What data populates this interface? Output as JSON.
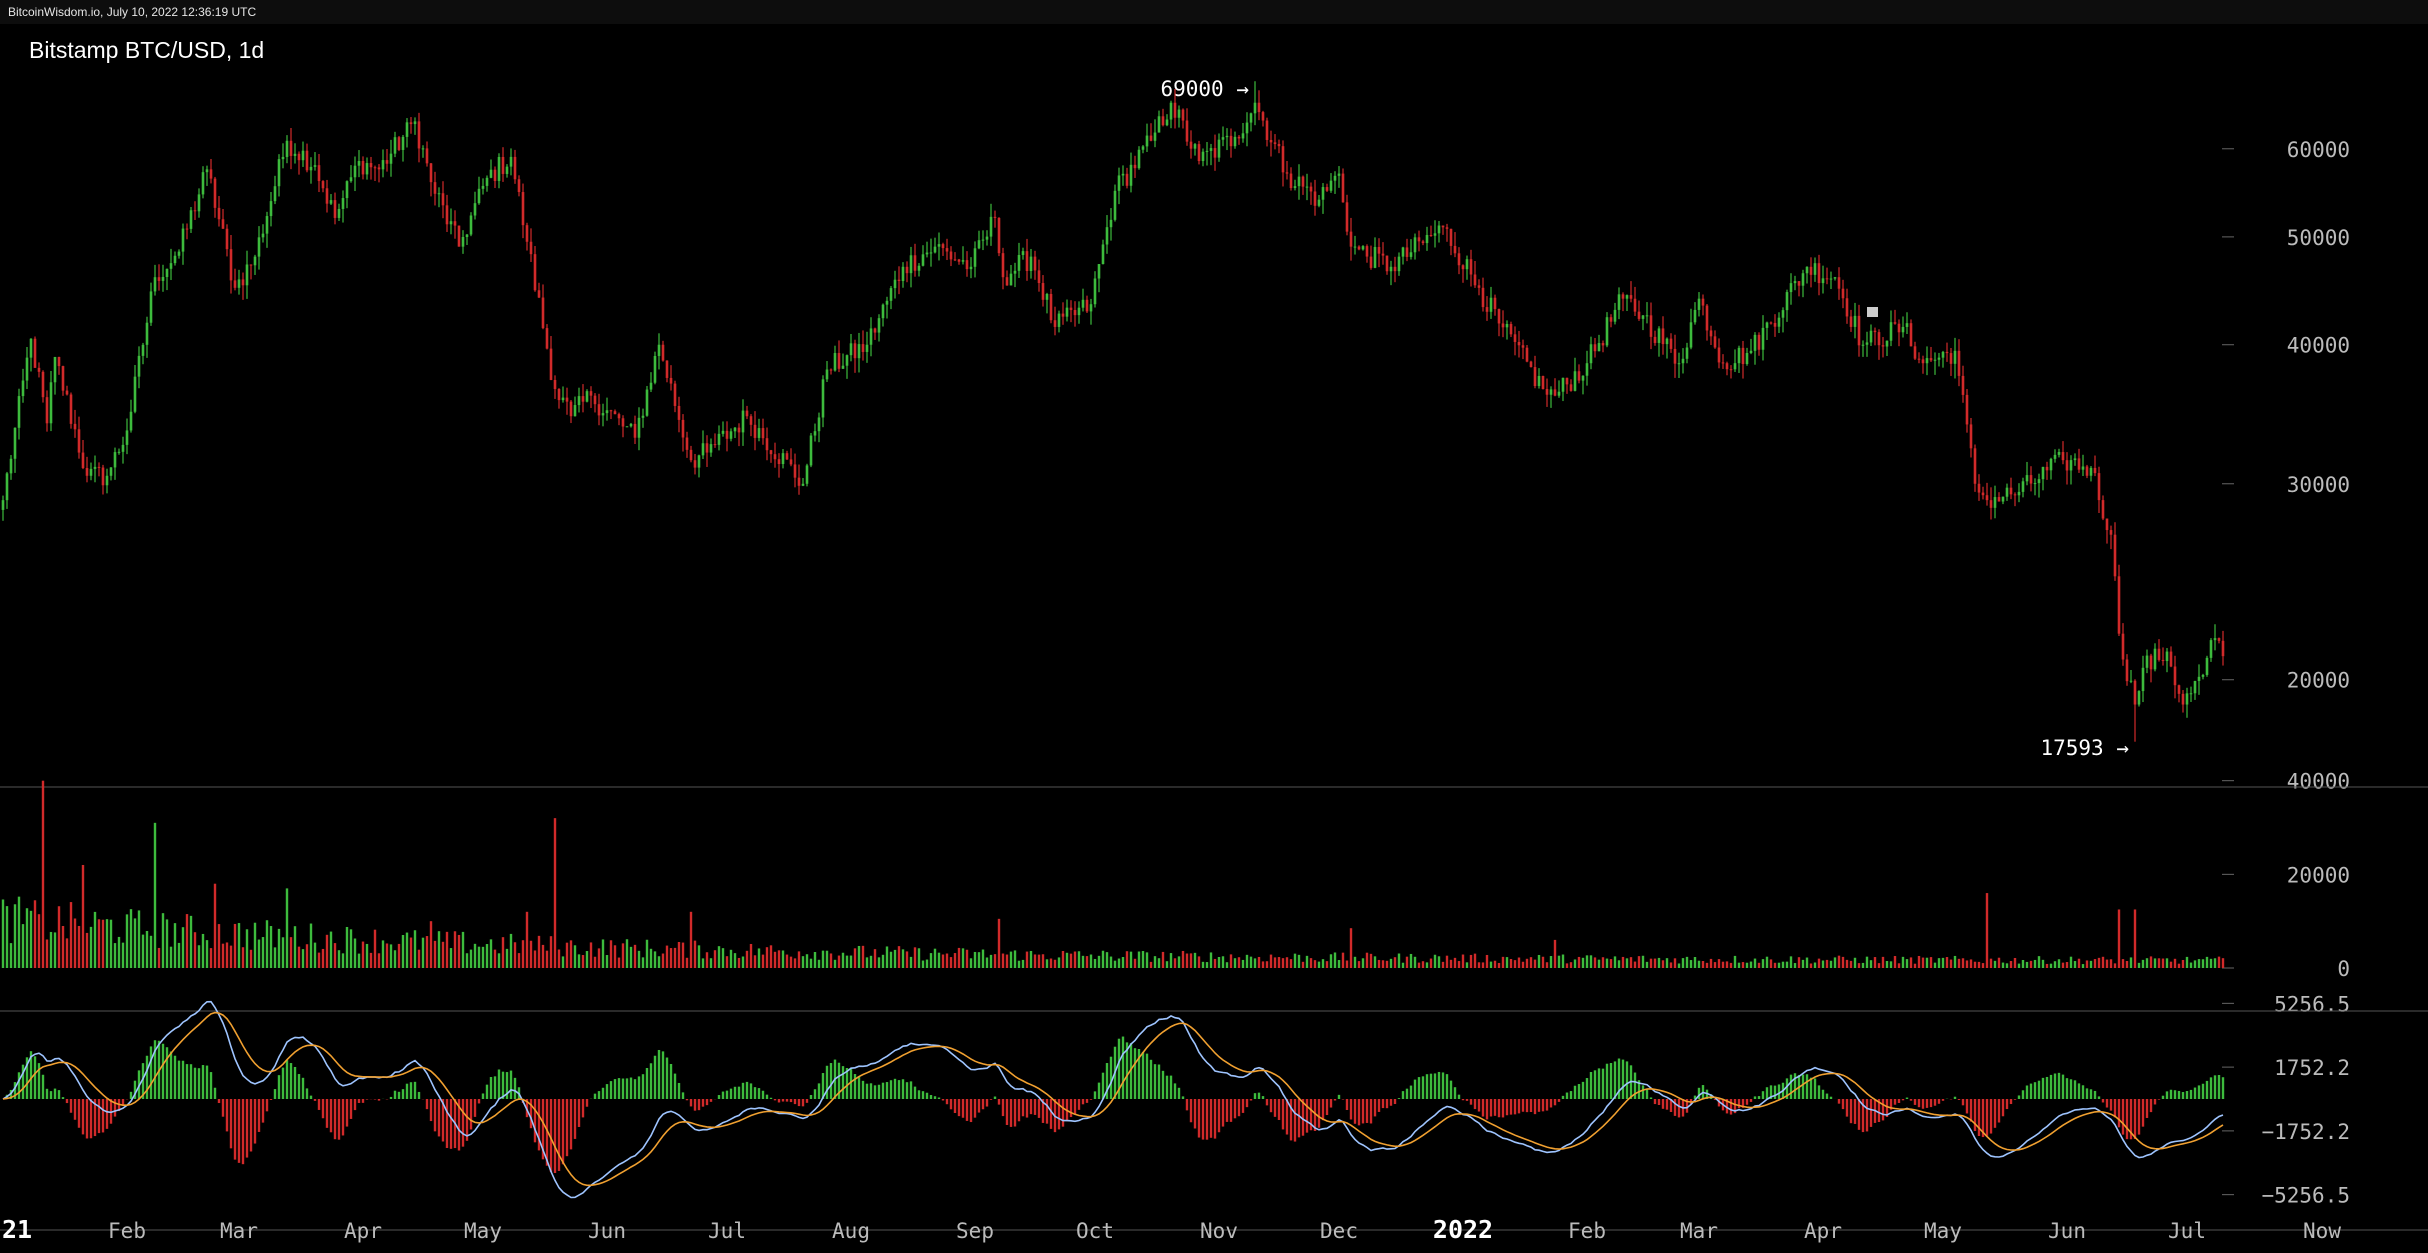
{
  "topbar": {
    "text": "BitcoinWisdom.io, July 10, 2022 12:36:19 UTC"
  },
  "colors": {
    "up": "#3dbb3d",
    "down": "#d12a2a",
    "macd": "#9ec4ff",
    "signal": "#f0a030",
    "axis": "#bbbbbb",
    "separator": "#555555"
  },
  "chart_data": [
    {
      "type": "candlestick",
      "title": "Bitstamp BTC/USD, 1d",
      "y_scale": "log",
      "y_ticks": [
        60000,
        50000,
        40000,
        30000,
        20000
      ],
      "ylim": [
        16800,
        73000
      ],
      "x_tick_labels": [
        "21",
        "Feb",
        "Mar",
        "Apr",
        "May",
        "Jun",
        "Jul",
        "Aug",
        "Sep",
        "Oct",
        "Nov",
        "Dec",
        "2022",
        "Feb",
        "Mar",
        "Apr",
        "May",
        "Jun",
        "Jul",
        "Now"
      ],
      "annotations": [
        {
          "text": "69000 →",
          "value": 69000
        },
        {
          "text": "17593 →",
          "value": 17593
        }
      ],
      "price_path": [
        [
          "2021-01-01",
          29000
        ],
        [
          "2021-01-08",
          40500
        ],
        [
          "2021-01-12",
          34000
        ],
        [
          "2021-01-14",
          39000
        ],
        [
          "2021-01-22",
          30500
        ],
        [
          "2021-01-27",
          30500
        ],
        [
          "2021-02-01",
          33500
        ],
        [
          "2021-02-08",
          46000
        ],
        [
          "2021-02-14",
          48500
        ],
        [
          "2021-02-21",
          57500
        ],
        [
          "2021-02-28",
          45000
        ],
        [
          "2021-03-05",
          48000
        ],
        [
          "2021-03-13",
          61000
        ],
        [
          "2021-03-20",
          58000
        ],
        [
          "2021-03-25",
          52000
        ],
        [
          "2021-03-31",
          58500
        ],
        [
          "2021-04-05",
          57500
        ],
        [
          "2021-04-14",
          63500
        ],
        [
          "2021-04-18",
          56000
        ],
        [
          "2021-04-25",
          49000
        ],
        [
          "2021-05-02",
          56500
        ],
        [
          "2021-05-08",
          59000
        ],
        [
          "2021-05-12",
          49500
        ],
        [
          "2021-05-19",
          36500
        ],
        [
          "2021-05-23",
          34500
        ],
        [
          "2021-05-28",
          36000
        ],
        [
          "2021-06-08",
          33000
        ],
        [
          "2021-06-14",
          40000
        ],
        [
          "2021-06-22",
          31500
        ],
        [
          "2021-06-26",
          32000
        ],
        [
          "2021-07-06",
          34500
        ],
        [
          "2021-07-20",
          30000
        ],
        [
          "2021-07-26",
          38000
        ],
        [
          "2021-08-05",
          40000
        ],
        [
          "2021-08-14",
          47000
        ],
        [
          "2021-08-22",
          49000
        ],
        [
          "2021-08-31",
          47000
        ],
        [
          "2021-09-06",
          52000
        ],
        [
          "2021-09-08",
          46000
        ],
        [
          "2021-09-15",
          48000
        ],
        [
          "2021-09-21",
          41500
        ],
        [
          "2021-09-30",
          43500
        ],
        [
          "2021-10-06",
          55000
        ],
        [
          "2021-10-15",
          61000
        ],
        [
          "2021-10-20",
          66000
        ],
        [
          "2021-10-27",
          58500
        ],
        [
          "2021-11-05",
          61500
        ],
        [
          "2021-11-10",
          66000
        ],
        [
          "2021-11-18",
          57000
        ],
        [
          "2021-11-26",
          54000
        ],
        [
          "2021-12-01",
          57000
        ],
        [
          "2021-12-04",
          49000
        ],
        [
          "2021-12-14",
          47000
        ],
        [
          "2021-12-27",
          51000
        ],
        [
          "2022-01-05",
          45000
        ],
        [
          "2022-01-10",
          41800
        ],
        [
          "2022-01-21",
          36500
        ],
        [
          "2022-01-24",
          36000
        ],
        [
          "2022-02-01",
          38500
        ],
        [
          "2022-02-10",
          44000
        ],
        [
          "2022-02-15",
          42500
        ],
        [
          "2022-02-24",
          38500
        ],
        [
          "2022-03-01",
          44000
        ],
        [
          "2022-03-07",
          38500
        ],
        [
          "2022-03-14",
          39500
        ],
        [
          "2022-03-28",
          47000
        ],
        [
          "2022-04-04",
          46000
        ],
        [
          "2022-04-11",
          40000
        ],
        [
          "2022-04-21",
          41500
        ],
        [
          "2022-04-26",
          38500
        ],
        [
          "2022-05-04",
          39500
        ],
        [
          "2022-05-09",
          30000
        ],
        [
          "2022-05-12",
          29000
        ],
        [
          "2022-05-20",
          29500
        ],
        [
          "2022-05-31",
          31500
        ],
        [
          "2022-06-07",
          31000
        ],
        [
          "2022-06-12",
          27000
        ],
        [
          "2022-06-14",
          22000
        ],
        [
          "2022-06-18",
          19000
        ],
        [
          "2022-06-20",
          20500
        ],
        [
          "2022-06-26",
          21200
        ],
        [
          "2022-06-30",
          19000
        ],
        [
          "2022-07-05",
          20200
        ],
        [
          "2022-07-08",
          21800
        ],
        [
          "2022-07-10",
          21000
        ]
      ]
    },
    {
      "type": "bar",
      "name": "volume",
      "y_ticks": [
        40000,
        20000,
        0
      ],
      "ylim": [
        0,
        41000
      ],
      "spikes": [
        [
          "2021-01-11",
          40000
        ],
        [
          "2021-01-21",
          22000
        ],
        [
          "2021-02-08",
          31000
        ],
        [
          "2021-02-23",
          18000
        ],
        [
          "2021-03-13",
          17000
        ],
        [
          "2021-04-18",
          10000
        ],
        [
          "2021-05-12",
          12000
        ],
        [
          "2021-05-19",
          32000
        ],
        [
          "2021-06-22",
          12000
        ],
        [
          "2021-09-07",
          10500
        ],
        [
          "2021-12-04",
          8500
        ],
        [
          "2022-01-24",
          6000
        ],
        [
          "2022-05-12",
          16000
        ],
        [
          "2022-06-14",
          12500
        ],
        [
          "2022-06-18",
          12500
        ]
      ]
    },
    {
      "type": "line",
      "name": "MACD",
      "y_ticks": [
        5256.5,
        1752.2,
        -1752.2,
        -5256.5
      ],
      "y_tick_labels": [
        "5256.5",
        "1752.2",
        "−1752.2",
        "−5256.5"
      ],
      "ylim": [
        -6100,
        6100
      ]
    }
  ]
}
